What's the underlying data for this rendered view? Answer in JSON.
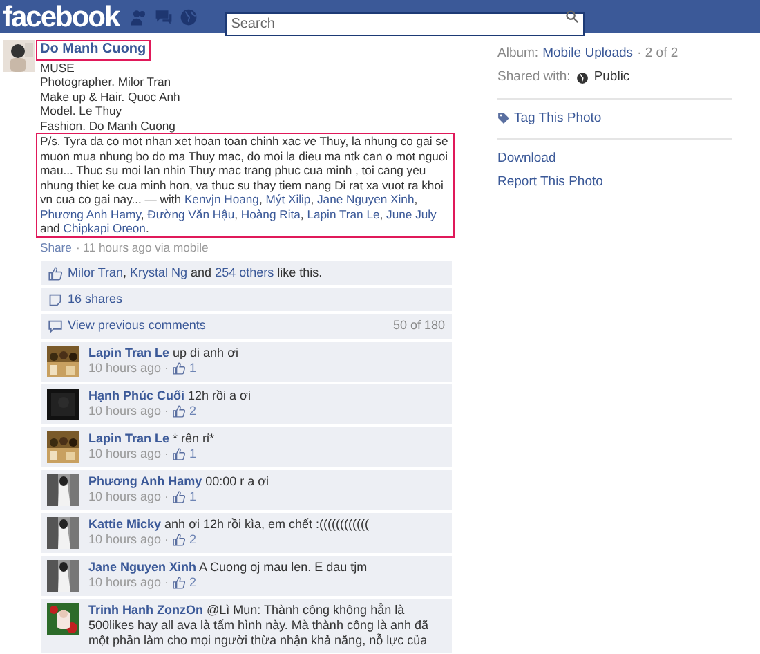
{
  "topbar": {
    "logo": "facebook",
    "search": {
      "placeholder": "Search"
    }
  },
  "post": {
    "author": "Do Manh Cuong",
    "author_highlighted": true,
    "lines": [
      "MUSE",
      "Photographer. Milor Tran",
      "Make up & Hair. Quoc Anh",
      "Model. Le Thuy",
      "Fashion. Do Manh Cuong"
    ],
    "postscript_highlighted": true,
    "postscript": "P/s. Tyra da co mot nhan xet hoan toan chinh xac ve Thuy, la nhung co gai se muon mua nhung bo do ma Thuy mac, do moi la dieu ma ntk can o mot nguoi mau... Thuc su moi lan nhin Thuy mac trang phuc cua minh , toi cang yeu nhung thiet ke cua minh hon, va thuc su thay tiem nang Di rat xa vuot ra khoi vn cua co gai nay... — with ",
    "tagged": [
      {
        "name": "Kenvjn Hoang",
        "after": ", "
      },
      {
        "name": "Mýt Xilip",
        "after": ", "
      },
      {
        "name": "Jane Nguyen Xinh",
        "after": ", "
      },
      {
        "name": "Phương Anh Hamy",
        "after": ", "
      },
      {
        "name": "Đường Văn Hậu",
        "after": ", "
      },
      {
        "name": "Hoàng Rita",
        "after": ", "
      },
      {
        "name": "Lapin Tran Le",
        "after": ", "
      },
      {
        "name": "June July",
        "after": " and "
      },
      {
        "name": "Chipkapi Oreon",
        "after": "."
      }
    ],
    "share": "Share",
    "time": "· 11 hours ago via mobile"
  },
  "likes": [
    {
      "name": "Milor Tran",
      "after": ", "
    },
    {
      "name": "Krystal Ng",
      "after": " and "
    },
    {
      "name": "254 others",
      "after": " like this."
    }
  ],
  "shares": "16 shares",
  "view_previous": {
    "label": "View previous comments",
    "count": "50 of 180"
  },
  "comments": [
    {
      "author": "Lapin Tran Le",
      "text": "up di anh ơi",
      "time": "10 hours ago ·",
      "likes": "1"
    },
    {
      "author": "Hạnh Phúc Cuối",
      "text": "12h rồi a ơi",
      "time": "10 hours ago ·",
      "likes": "2"
    },
    {
      "author": "Lapin Tran Le",
      "text": "* rên rỉ*",
      "time": "10 hours ago ·",
      "likes": "1"
    },
    {
      "author": "Phương Anh Hamy",
      "text": "00:00 r a ơi",
      "time": "10 hours ago ·",
      "likes": "1"
    },
    {
      "author": "Kattie Micky",
      "text": "anh ơi 12h rồi kìa, em chết :((((((((((((",
      "time": "10 hours ago ·",
      "likes": "2"
    },
    {
      "author": "Jane Nguyen Xinh",
      "text": "A Cuong oj mau len. E dau tjm",
      "time": "10 hours ago ·",
      "likes": "2"
    },
    {
      "author": "Trinh Hanh ZonzOn",
      "text": "@Lì Mun: Thành công không hẳn là 500likes hay all ava là tấm hình này. Mà thành công là anh đã một phần làm cho mọi người thừa nhận khả năng, nỗ lực của"
    }
  ],
  "sidebar": {
    "album_label": "Album:",
    "album": "Mobile Uploads",
    "album_pos": "· 2 of 2",
    "shared_label": "Shared with:",
    "shared": "Public",
    "tag": "Tag This Photo",
    "download": "Download",
    "report": "Report This Photo"
  }
}
